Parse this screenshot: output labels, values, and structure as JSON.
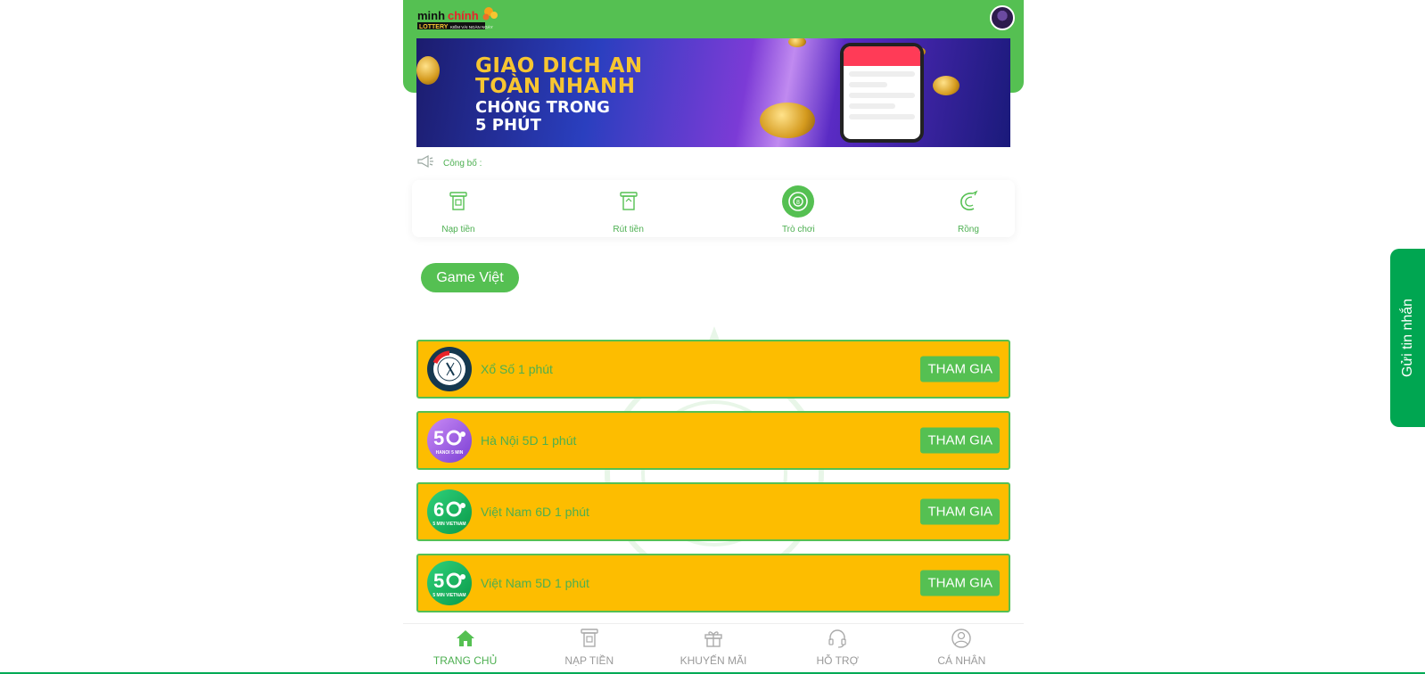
{
  "header": {
    "logo_text": "minhchinh",
    "logo_sub": "LOTTERY",
    "logo_tagline": "KIẾM VÀI NGÀN NGÀY",
    "avatar_icon": "user-avatar"
  },
  "banner": {
    "line1": "GIAO DICH AN",
    "line2": "TOÀN NHANH",
    "line3": "CHÓNG TRONG",
    "line4": "5 PHÚT"
  },
  "announcement": {
    "label": "Công bố :",
    "icon": "megaphone-icon"
  },
  "quick_actions": [
    {
      "label": "Nạp tiền",
      "icon": "deposit-icon",
      "active": false
    },
    {
      "label": "Rút tiền",
      "icon": "withdraw-icon",
      "active": false
    },
    {
      "label": "Trò chơi",
      "icon": "game-icon",
      "active": true
    },
    {
      "label": "Rồng",
      "icon": "dragon-icon",
      "active": false
    }
  ],
  "category": {
    "label": "Game Việt"
  },
  "games": [
    {
      "title": "Xổ Số 1 phút",
      "button": "THAM GIA",
      "icon": "clock-lottery-icon"
    },
    {
      "title": "Hà Nội 5D 1 phút",
      "button": "THAM GIA",
      "icon": "hanoi-5d-icon"
    },
    {
      "title": "Việt Nam 6D 1 phút",
      "button": "THAM GIA",
      "icon": "vietnam-6d-icon"
    },
    {
      "title": "Việt Nam 5D 1 phút",
      "button": "THAM GIA",
      "icon": "vietnam-5d-icon"
    }
  ],
  "bottom_nav": [
    {
      "label": "TRANG CHỦ",
      "icon": "home-icon",
      "active": true
    },
    {
      "label": "NẠP TIỀN",
      "icon": "deposit-icon",
      "active": false
    },
    {
      "label": "KHUYẾN MÃI",
      "icon": "gift-icon",
      "active": false
    },
    {
      "label": "HỖ TRỢ",
      "icon": "headset-icon",
      "active": false
    },
    {
      "label": "CÁ NHÂN",
      "icon": "user-icon",
      "active": false
    }
  ],
  "side_tab": {
    "label": "Gửi tin nhắn"
  },
  "colors": {
    "primary_green": "#55c052",
    "card_yellow": "#fdbd00",
    "side_tab_green": "#00a651",
    "banner_gold": "#f7c531"
  }
}
